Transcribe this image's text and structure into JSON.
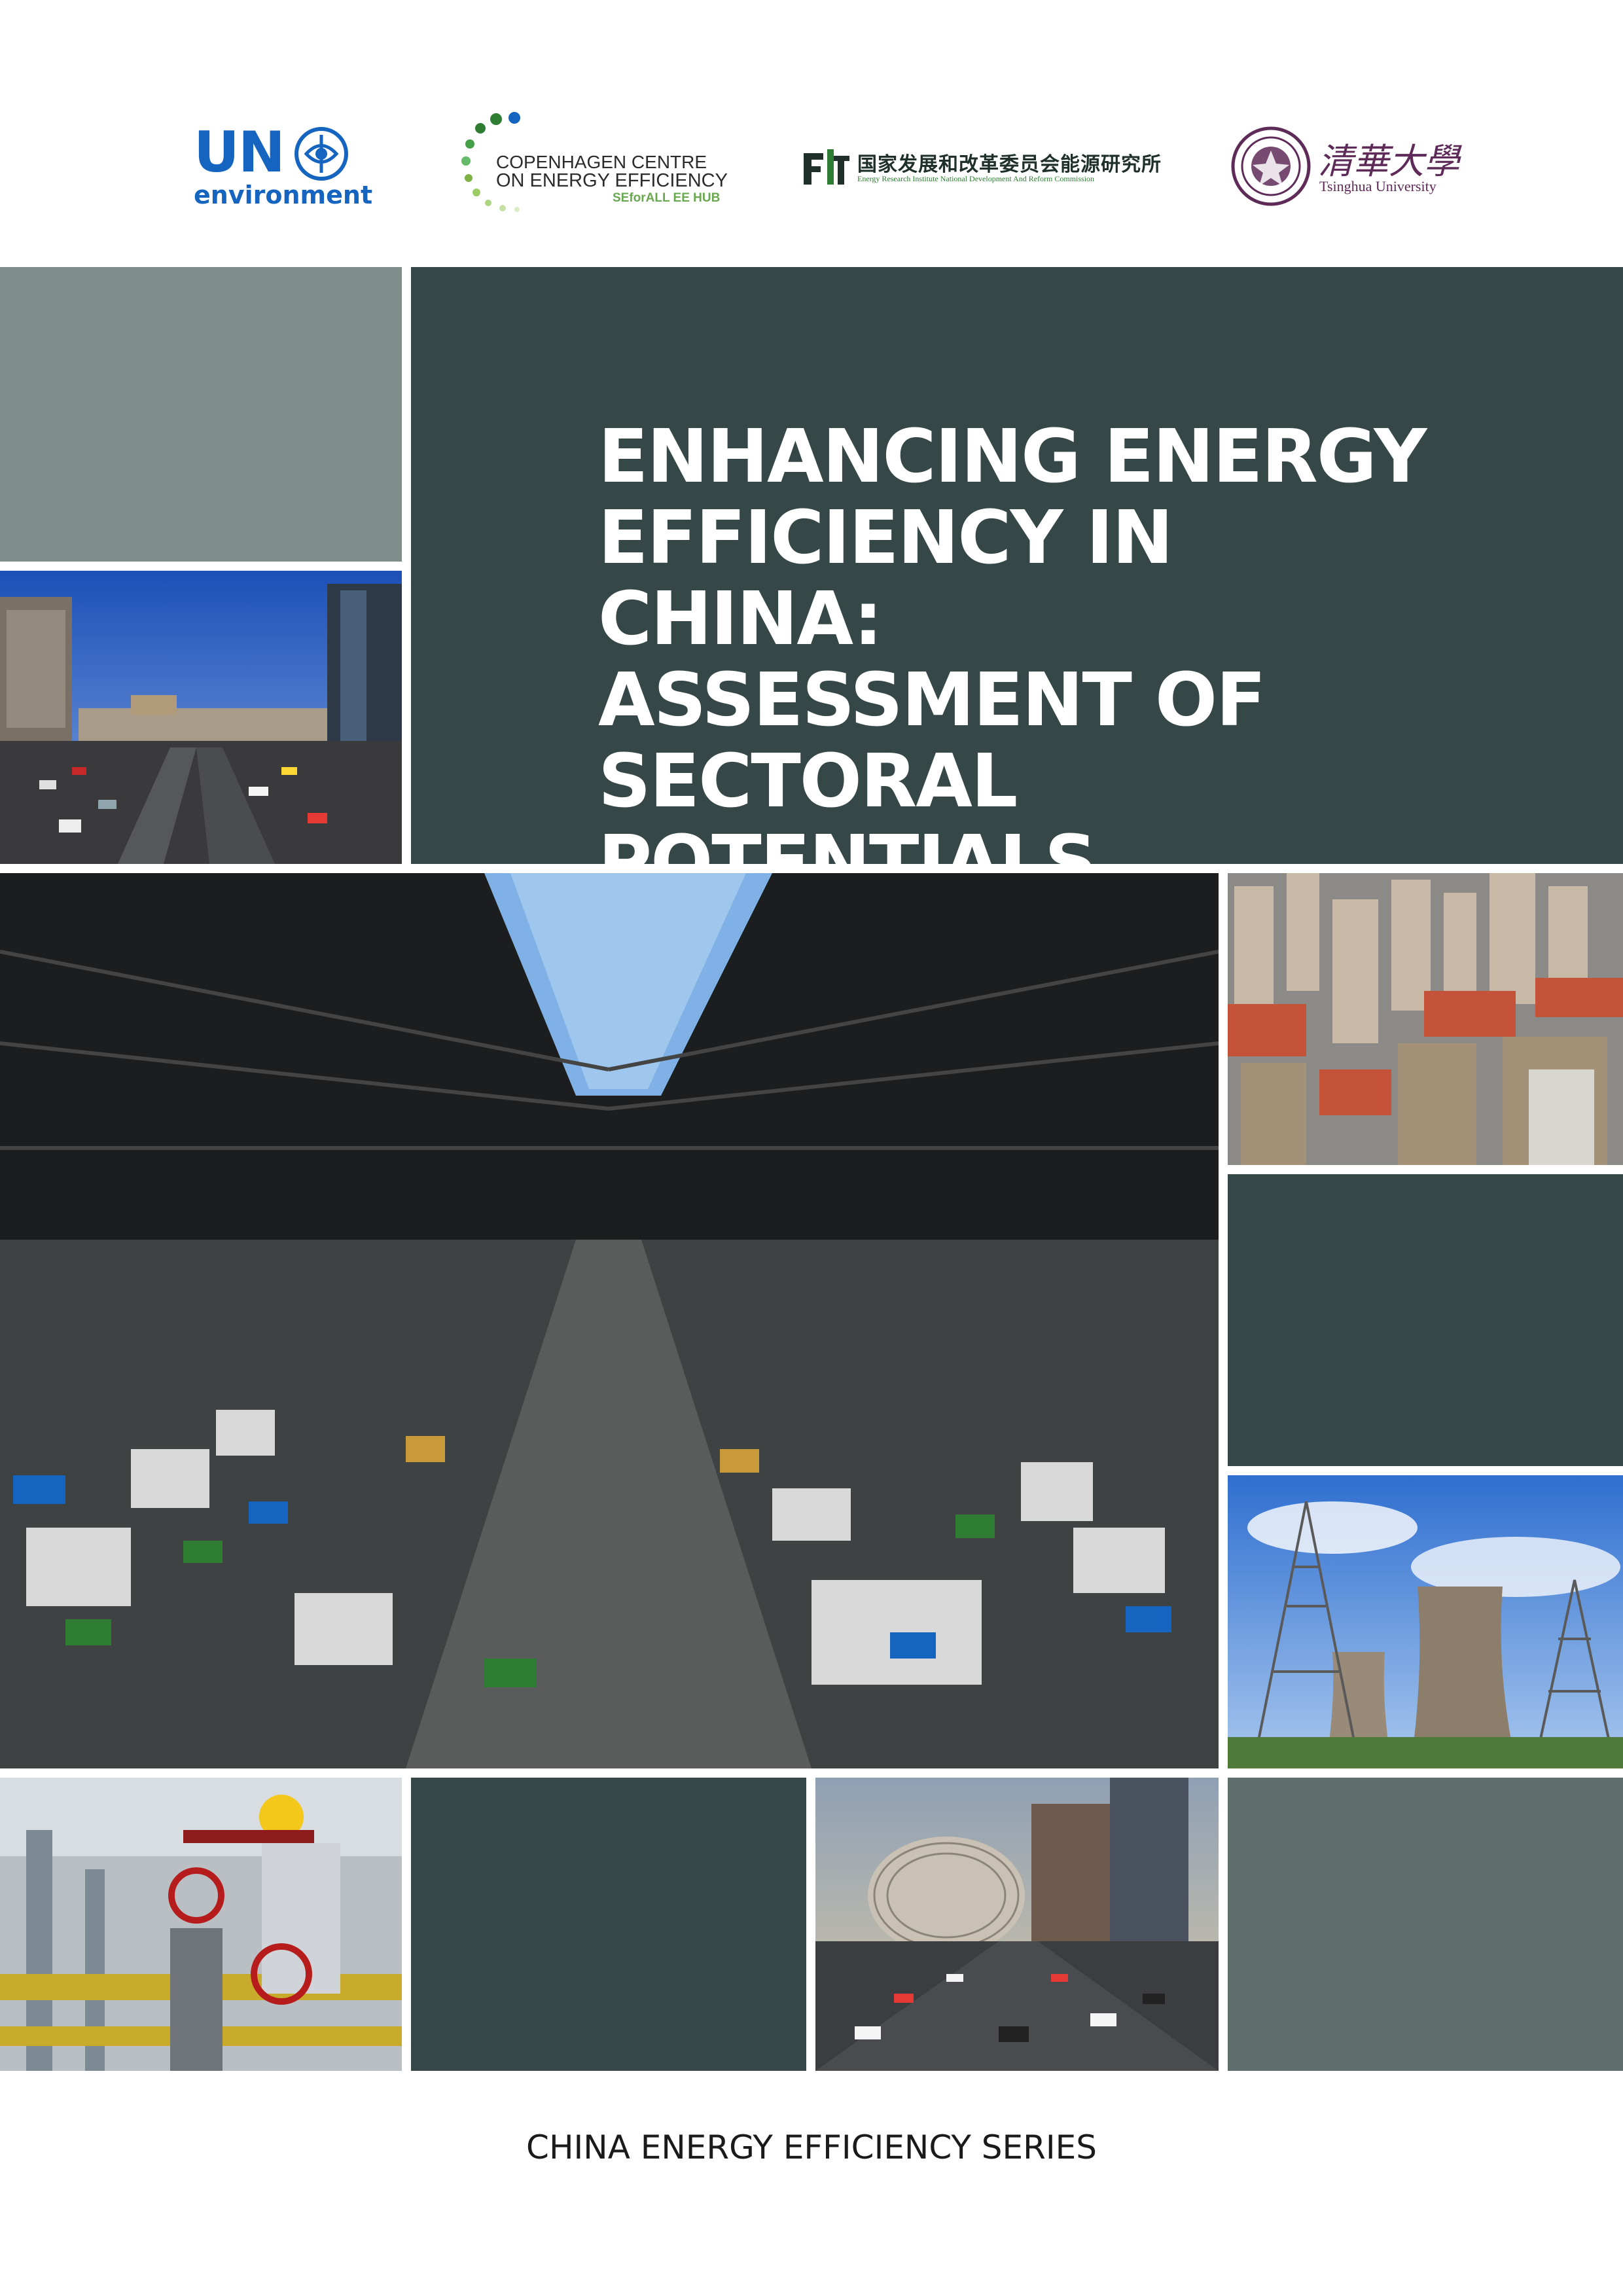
{
  "logos": {
    "un": {
      "main": "UN",
      "sub": "environment"
    },
    "copenhagen": {
      "line1": "COPENHAGEN CENTRE",
      "line2": "ON ENERGY EFFICIENCY",
      "line3": "SEforALL EE HUB"
    },
    "eri": {
      "cn": "国家发展和改革委员会能源研究所",
      "en": "Energy Research Institute National Development And Reform Commission"
    },
    "tsinghua": {
      "cn": "清華大學",
      "en": "Tsinghua University"
    }
  },
  "title": {
    "line1": "ENHANCING ENERGY",
    "line2": "EFFICIENCY IN CHINA:",
    "line3": "ASSESSMENT OF",
    "line4": "SECTORAL POTENTIALS"
  },
  "series": "CHINA ENERGY EFFICIENCY SERIES",
  "colors": {
    "slate": "#364747",
    "gray": "#7e8c8a",
    "un_blue": "#1565c0",
    "tsinghua_purple": "#5e2a58"
  }
}
